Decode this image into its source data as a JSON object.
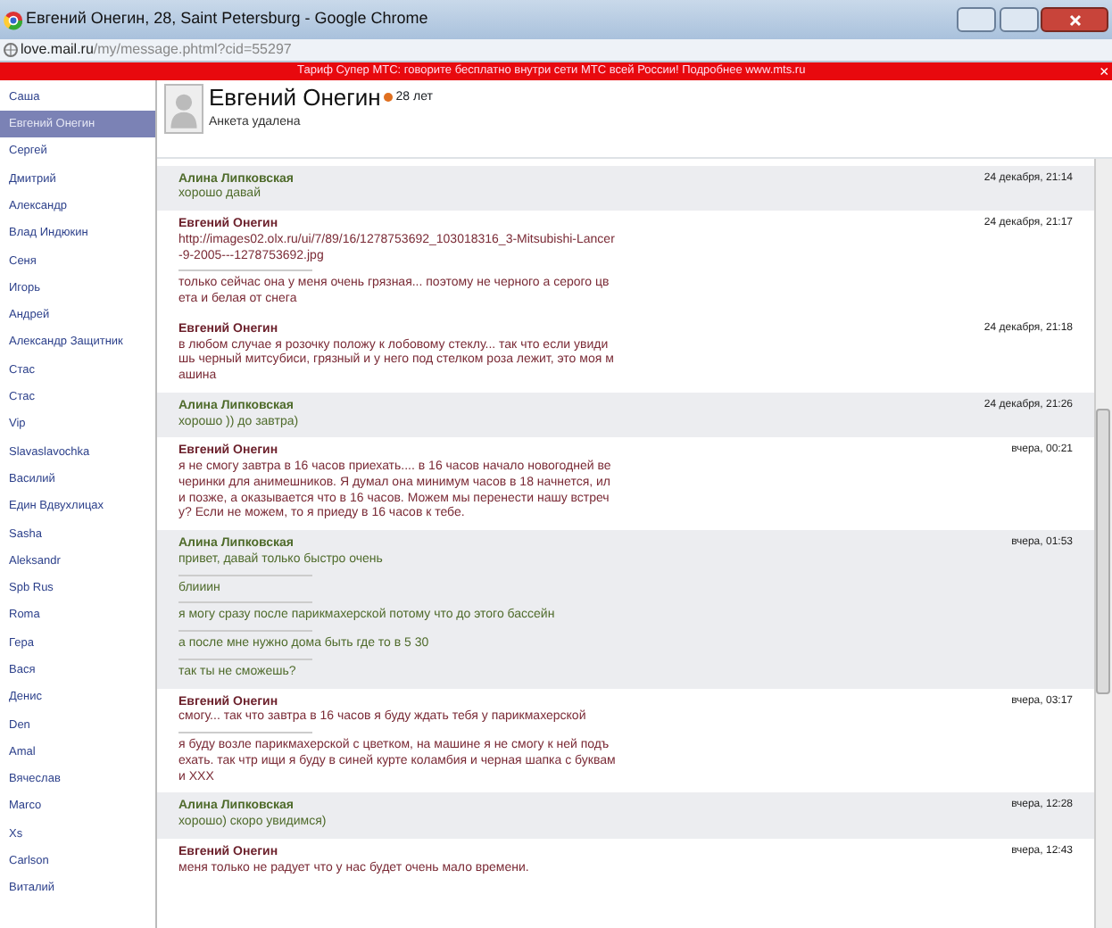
{
  "window": {
    "title": "Евгений Онегин, 28, Saint Petersburg - Google Chrome"
  },
  "address_bar": {
    "host": "love.mail.ru",
    "path": "/my/message.phtml?cid=55297"
  },
  "banner": {
    "text": "Тариф Супер МТС: говорите бесплатно внутри сети МТС всей России! Подробнее www.mts.ru",
    "close": "×"
  },
  "sidebar": {
    "items": [
      {
        "label": "Саша",
        "selected": false
      },
      {
        "label": "Евгений Онегин",
        "selected": true
      },
      {
        "label": "Сергей",
        "selected": false
      },
      {
        "label": "Дмитрий",
        "selected": false
      },
      {
        "label": "Александр",
        "selected": false
      },
      {
        "label": "Влад Индюкин",
        "selected": false
      },
      {
        "label": "Сеня",
        "selected": false
      },
      {
        "label": "Игорь",
        "selected": false
      },
      {
        "label": "Андрей",
        "selected": false
      },
      {
        "label": "Александр Защитник",
        "selected": false
      },
      {
        "label": "Стас",
        "selected": false
      },
      {
        "label": "Стас",
        "selected": false
      },
      {
        "label": "Vip",
        "selected": false
      },
      {
        "label": "Slavaslavochka",
        "selected": false
      },
      {
        "label": "Василий",
        "selected": false
      },
      {
        "label": "Един Вдвухлицах",
        "selected": false
      },
      {
        "label": "Sasha",
        "selected": false
      },
      {
        "label": "Aleksandr",
        "selected": false
      },
      {
        "label": "Spb Rus",
        "selected": false
      },
      {
        "label": "Roma",
        "selected": false
      },
      {
        "label": "Гера",
        "selected": false
      },
      {
        "label": "Вася",
        "selected": false
      },
      {
        "label": "Денис",
        "selected": false
      },
      {
        "label": "Den",
        "selected": false
      },
      {
        "label": "Amal",
        "selected": false
      },
      {
        "label": "Вячеслав",
        "selected": false
      },
      {
        "label": "Marco",
        "selected": false
      },
      {
        "label": "Xs",
        "selected": false
      },
      {
        "label": "Carlson",
        "selected": false
      },
      {
        "label": "Виталий",
        "selected": false
      }
    ]
  },
  "profile": {
    "name": "Евгений Онегин",
    "age": "28 лет",
    "status": "Анкета удалена"
  },
  "messages": [
    {
      "kind": "her",
      "sender": "Алина Липковская",
      "time": "24 декабря, 21:14",
      "parts": [
        "хорошо давай"
      ]
    },
    {
      "kind": "him",
      "sender": "Евгений Онегин",
      "time": "24 декабря, 21:17",
      "parts": [
        "http://images02.olx.ru/ui/7/89/16/1278753692_103018316_3-Mitsubishi-Lancer-9-2005---1278753692.jpg",
        "только сейчас она у меня очень грязная... поэтому не черного а серого цвета и белая от снега"
      ]
    },
    {
      "kind": "him",
      "sender": "Евгений Онегин",
      "time": "24 декабря, 21:18",
      "parts": [
        "в любом случае я розочку положу к лобовому стеклу... так что если увидишь черный митсубиси, грязный и у него под стелком роза лежит, это моя машина"
      ]
    },
    {
      "kind": "her",
      "sender": "Алина Липковская",
      "time": "24 декабря, 21:26",
      "parts": [
        "хорошо )) до завтра)"
      ]
    },
    {
      "kind": "him",
      "sender": "Евгений Онегин",
      "time": "вчера, 00:21",
      "parts": [
        "я не смогу завтра в 16 часов приехать.... в 16 часов начало новогодней вечеринки для анимешников. Я думал она минимум часов в 18 начнется, или позже, а оказывается что в 16 часов. Можем мы перенести нашу встречу? Если не можем, то я приеду в 16 часов к тебе."
      ]
    },
    {
      "kind": "her",
      "sender": "Алина Липковская",
      "time": "вчера, 01:53",
      "parts": [
        "привет, давай только быстро очень",
        "блииин",
        "я могу сразу после парикмахерской потому что до этого бассейн",
        "а после мне нужно дома быть где то в 5 30",
        "так ты не сможешь?"
      ]
    },
    {
      "kind": "him",
      "sender": "Евгений Онегин",
      "time": "вчера, 03:17",
      "parts": [
        "смогу... так что завтра в 16 часов я буду ждать тебя у парикмахерской",
        "я буду возле парикмахерской с цветком, на машине я не смогу к ней подъехать. так чтр ищи я буду в синей курте коламбия и черная шапка с буквами XXX"
      ]
    },
    {
      "kind": "her",
      "sender": "Алина Липковская",
      "time": "вчера, 12:28",
      "parts": [
        "хорошо) скоро увидимся)"
      ]
    },
    {
      "kind": "him",
      "sender": "Евгений Онегин",
      "time": "вчера, 12:43",
      "parts": [
        "меня только не радует что у нас будет очень мало времени."
      ]
    }
  ]
}
